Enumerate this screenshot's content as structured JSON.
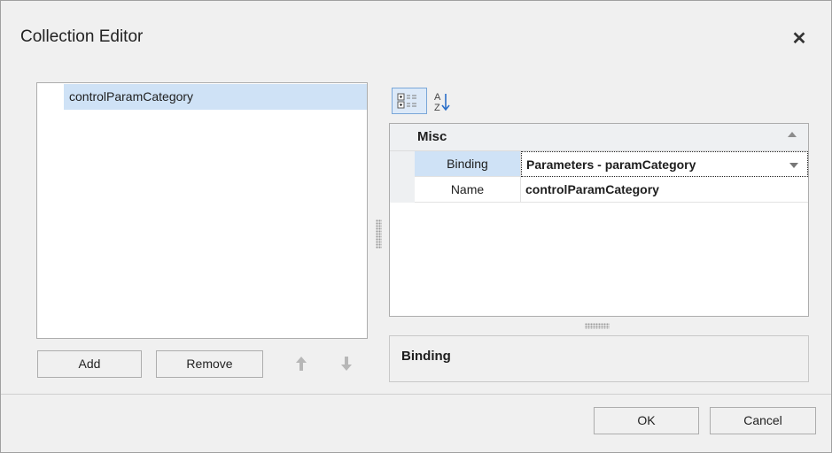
{
  "window": {
    "title": "Collection Editor",
    "close_glyph": "✕"
  },
  "collection": {
    "items": [
      {
        "label": "controlParamCategory",
        "selected": true
      }
    ]
  },
  "buttons": {
    "add": "Add",
    "remove": "Remove",
    "move_up_icon": "arrow-up",
    "move_down_icon": "arrow-down",
    "ok": "OK",
    "cancel": "Cancel"
  },
  "toolbar": {
    "categorized_icon": "categorized-view",
    "alphabetical_icon": "sort-alphabetical"
  },
  "property_grid": {
    "category": "Misc",
    "rows": [
      {
        "name": "Binding",
        "value": "Parameters - paramCategory",
        "has_dropdown": true,
        "selected": true
      },
      {
        "name": "Name",
        "value": "controlParamCategory",
        "has_dropdown": false,
        "selected": false
      }
    ]
  },
  "description": {
    "title": "Binding"
  },
  "colors": {
    "selection": "#cfe2f6",
    "background": "#f0f0f0",
    "disabled_arrow": "#b7b7b7"
  }
}
